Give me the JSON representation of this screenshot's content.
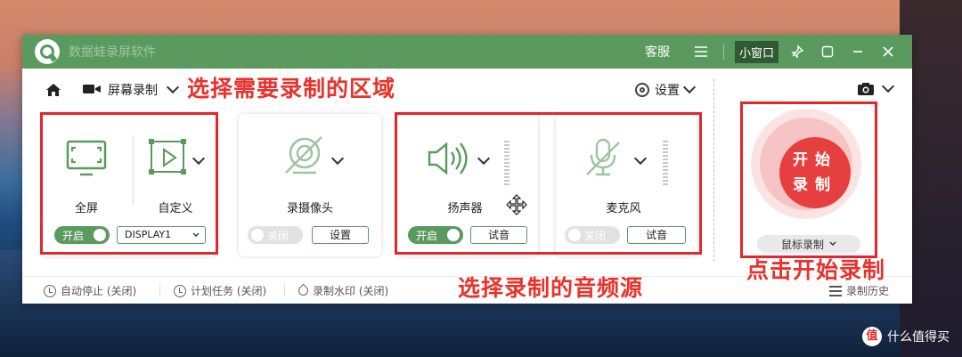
{
  "app": {
    "title": "数据蛙录屏软件"
  },
  "titlebar": {
    "service": "客服",
    "mini_window": "小窗口"
  },
  "toolbar": {
    "mode_label": "屏幕录制",
    "settings_label": "设置"
  },
  "annotations": {
    "select_area": "选择需要录制的区域",
    "select_audio": "选择录制的音频源",
    "click_start": "点击开始录制"
  },
  "area": {
    "fullscreen_label": "全屏",
    "custom_label": "自定义",
    "toggle_label": "开启",
    "toggle_on": true,
    "display_select": "DISPLAY1"
  },
  "webcam": {
    "label": "录摄像头",
    "toggle_label": "关闭",
    "toggle_on": false,
    "settings_button": "设置"
  },
  "speaker": {
    "label": "扬声器",
    "toggle_label": "开启",
    "toggle_on": true,
    "test_button": "试音"
  },
  "microphone": {
    "label": "麦克风",
    "toggle_label": "关闭",
    "toggle_on": false,
    "test_button": "试音"
  },
  "record": {
    "line1": "开始",
    "line2": "录制",
    "mouse_record": "鼠标录制"
  },
  "bottom": {
    "auto_stop": "自动停止 (关闭)",
    "schedule": "计划任务 (关闭)",
    "watermark": "录制水印 (关闭)",
    "history": "录制历史"
  },
  "site_watermark": {
    "badge": "值",
    "text": "什么值得买"
  },
  "colors": {
    "brand_green": "#5a9a5e",
    "record_red": "#e5403f",
    "annotation_red": "#e8322c"
  }
}
